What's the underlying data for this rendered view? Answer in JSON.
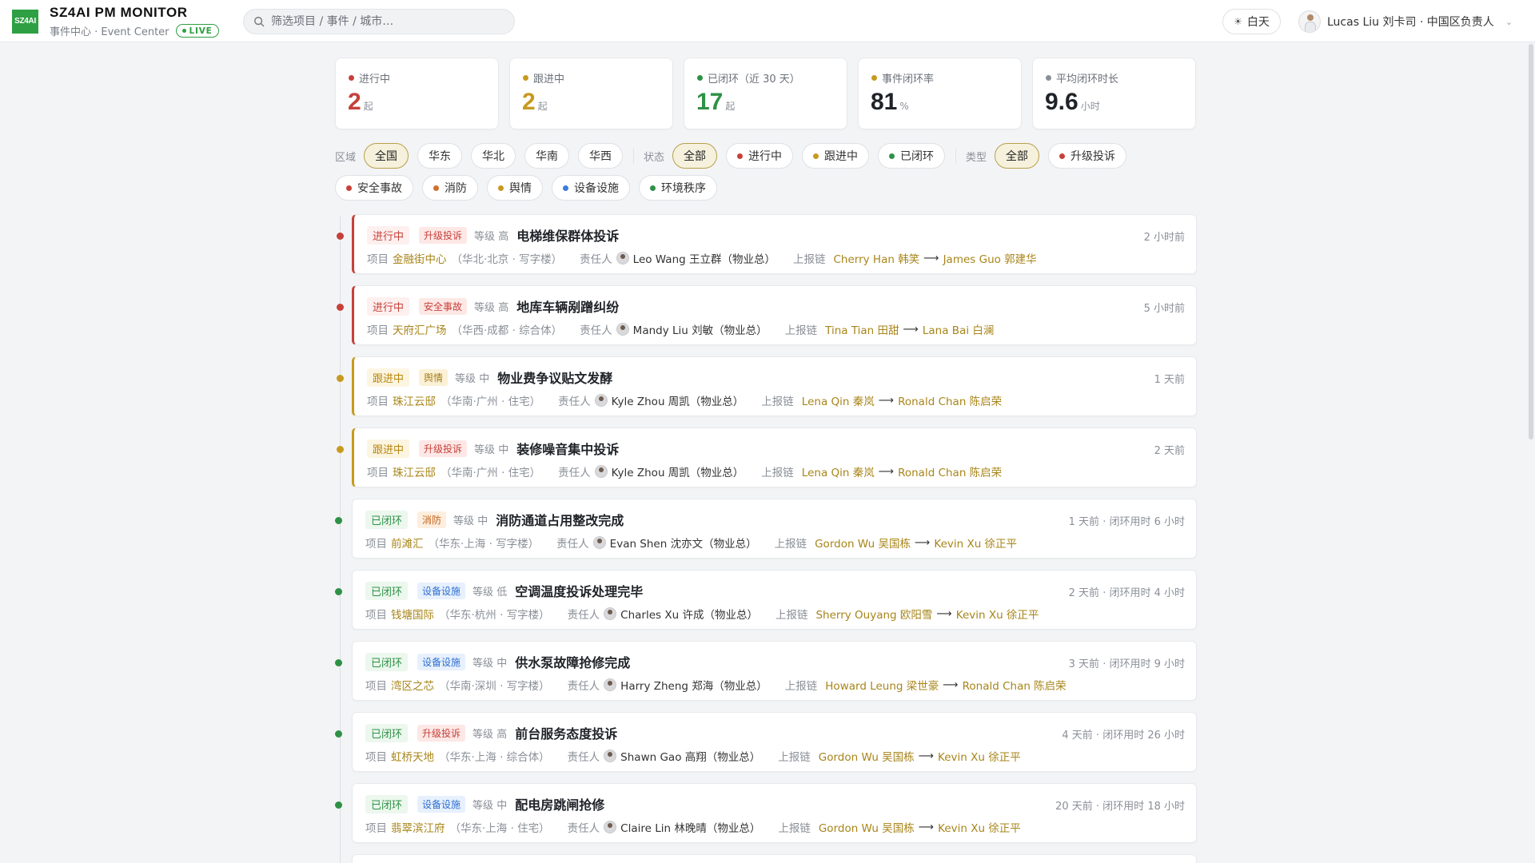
{
  "header": {
    "logo_text": "SZ4AI",
    "app_title": "SZ4AI PM MONITOR",
    "subtitle": "事件中心 · Event Center",
    "live": "LIVE",
    "search_placeholder": "筛选项目 / 事件 / 城市…",
    "theme_label": "白天",
    "user_label": "Lucas Liu 刘卡司 · 中国区负责人",
    "accent": "#2ea043"
  },
  "stats": [
    {
      "label": "进行中",
      "value": "2",
      "unit": "起",
      "color": "#c6403a"
    },
    {
      "label": "跟进中",
      "value": "2",
      "unit": "起",
      "color": "#c79a1f"
    },
    {
      "label": "已闭环（近 30 天）",
      "value": "17",
      "unit": "起",
      "color": "#2e9146"
    },
    {
      "label": "事件闭环率",
      "value": "81",
      "unit": "%",
      "color": "#c79a1f"
    },
    {
      "label": "平均闭环时长",
      "value": "9.6",
      "unit": "小时",
      "color": "#8a8f97"
    }
  ],
  "filters": {
    "region_label": "区域",
    "regions": [
      "全国",
      "华东",
      "华北",
      "华南",
      "华西"
    ],
    "status_label": "状态",
    "statuses": [
      "全部",
      "进行中",
      "跟进中",
      "已闭环"
    ],
    "type_label": "类型",
    "types": [
      "全部",
      "升级投诉",
      "安全事故",
      "消防",
      "舆情",
      "设备设施",
      "环境秩序"
    ]
  },
  "labels": {
    "level": "等级",
    "project": "项目",
    "owner": "责任人",
    "chain": "上报链"
  },
  "events": [
    {
      "status": "进行中",
      "tag": "升级投诉",
      "level": "高",
      "title": "电梯维保群体投诉",
      "time": "2 小时前",
      "project": "金融街中心",
      "region": "（华北·北京 · 写字楼）",
      "owner": "Leo Wang 王立群（物业总）",
      "from": "Cherry Han 韩笑",
      "to": "James Guo 郭建华"
    },
    {
      "status": "进行中",
      "tag": "安全事故",
      "level": "高",
      "title": "地库车辆剐蹭纠纷",
      "time": "5 小时前",
      "project": "天府汇广场",
      "region": "（华西·成都 · 综合体）",
      "owner": "Mandy Liu 刘敏（物业总）",
      "from": "Tina Tian 田甜",
      "to": "Lana Bai 白澜"
    },
    {
      "status": "跟进中",
      "tag": "舆情",
      "level": "中",
      "title": "物业费争议贴文发酵",
      "time": "1 天前",
      "project": "珠江云邸",
      "region": "（华南·广州 · 住宅）",
      "owner": "Kyle Zhou 周凯（物业总）",
      "from": "Lena Qin 秦岚",
      "to": "Ronald Chan 陈启荣"
    },
    {
      "status": "跟进中",
      "tag": "升级投诉",
      "level": "中",
      "title": "装修噪音集中投诉",
      "time": "2 天前",
      "project": "珠江云邸",
      "region": "（华南·广州 · 住宅）",
      "owner": "Kyle Zhou 周凯（物业总）",
      "from": "Lena Qin 秦岚",
      "to": "Ronald Chan 陈启荣"
    },
    {
      "status": "已闭环",
      "tag": "消防",
      "level": "中",
      "title": "消防通道占用整改完成",
      "time": "1 天前 · 闭环用时 6 小时",
      "project": "前滩汇",
      "region": "（华东·上海 · 写字楼）",
      "owner": "Evan Shen 沈亦文（物业总）",
      "from": "Gordon Wu 吴国栋",
      "to": "Kevin Xu 徐正平"
    },
    {
      "status": "已闭环",
      "tag": "设备设施",
      "level": "低",
      "title": "空调温度投诉处理完毕",
      "time": "2 天前 · 闭环用时 4 小时",
      "project": "钱塘国际",
      "region": "（华东·杭州 · 写字楼）",
      "owner": "Charles Xu 许成（物业总）",
      "from": "Sherry Ouyang 欧阳雪",
      "to": "Kevin Xu 徐正平"
    },
    {
      "status": "已闭环",
      "tag": "设备设施",
      "level": "中",
      "title": "供水泵故障抢修完成",
      "time": "3 天前 · 闭环用时 9 小时",
      "project": "湾区之芯",
      "region": "（华南·深圳 · 写字楼）",
      "owner": "Harry Zheng 郑海（物业总）",
      "from": "Howard Leung 梁世豪",
      "to": "Ronald Chan 陈启荣"
    },
    {
      "status": "已闭环",
      "tag": "升级投诉",
      "level": "高",
      "title": "前台服务态度投诉",
      "time": "4 天前 · 闭环用时 26 小时",
      "project": "虹桥天地",
      "region": "（华东·上海 · 综合体）",
      "owner": "Shawn Gao 高翔（物业总）",
      "from": "Gordon Wu 吴国栋",
      "to": "Kevin Xu 徐正平"
    },
    {
      "status": "已闭环",
      "tag": "设备设施",
      "level": "中",
      "title": "配电房跳闸抢修",
      "time": "20 天前 · 闭环用时 18 小时",
      "project": "翡翠滨江府",
      "region": "（华东·上海 · 住宅）",
      "owner": "Claire Lin 林晚晴（物业总）",
      "from": "Gordon Wu 吴国栋",
      "to": "Kevin Xu 徐正平"
    }
  ]
}
